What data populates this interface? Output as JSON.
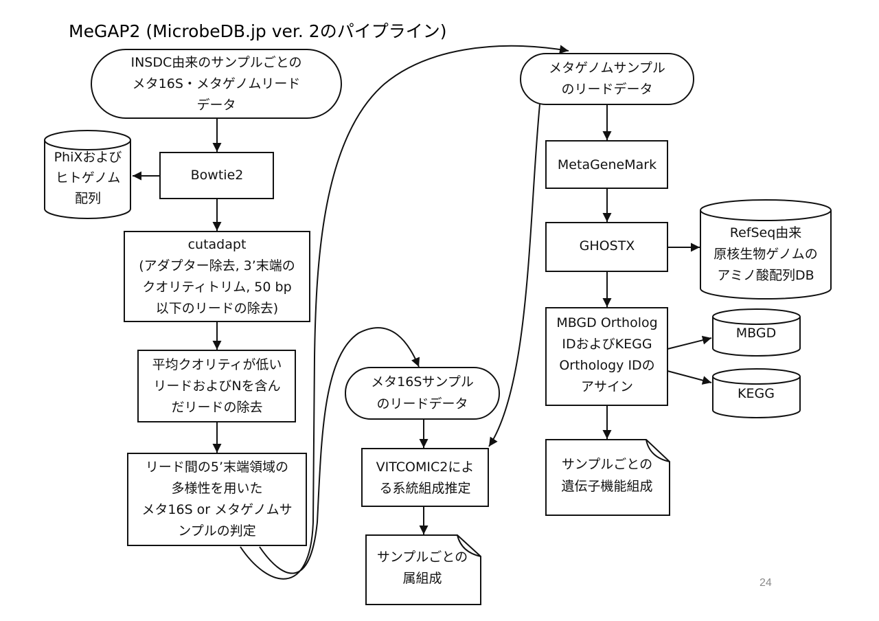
{
  "title": "MeGAP2 (MicrobeDB.jp ver. 2のパイプライン)",
  "page_number": "24",
  "nodes": {
    "insdc_reads": {
      "lines": [
        "INSDC由来のサンプルごとの",
        "メタ16S・メタゲノムリード",
        "データ"
      ]
    },
    "bowtie2": {
      "lines": [
        "Bowtie2"
      ]
    },
    "phix_human": {
      "lines": [
        "PhiXおよび",
        "ヒトゲノム",
        "配列"
      ]
    },
    "cutadapt": {
      "lines": [
        "cutadapt",
        "(アダプター除去, 3’末端の",
        "クオリティトリム, 50 bp",
        "以下のリードの除去)"
      ]
    },
    "quality_filter": {
      "lines": [
        "平均クオリティが低い",
        "リードおよびNを含ん",
        "だリードの除去"
      ]
    },
    "classify": {
      "lines": [
        "リード間の5’末端領域の",
        "多様性を用いた",
        "メタ16S or メタゲノムサ",
        "ンプルの判定"
      ]
    },
    "meta16s_reads": {
      "lines": [
        "メタ16Sサンプル",
        "のリードデータ"
      ]
    },
    "vitcomic2": {
      "lines": [
        "VITCOMIC2によ",
        "る系統組成推定"
      ]
    },
    "genus_composition": {
      "lines": [
        "サンプルごとの",
        "属組成"
      ]
    },
    "metagenome_reads": {
      "lines": [
        "メタゲノムサンプル",
        "のリードデータ"
      ]
    },
    "metagenemark": {
      "lines": [
        "MetaGeneMark"
      ]
    },
    "ghostx": {
      "lines": [
        "GHOSTX"
      ]
    },
    "refseq_db": {
      "lines": [
        "RefSeq由来",
        "原核生物ゲノムの",
        "アミノ酸配列DB"
      ]
    },
    "ortholog_assign": {
      "lines": [
        "MBGD Ortholog",
        "IDおよびKEGG",
        "Orthology IDの",
        "アサイン"
      ]
    },
    "mbgd": {
      "lines": [
        "MBGD"
      ]
    },
    "kegg": {
      "lines": [
        "KEGG"
      ]
    },
    "gene_function": {
      "lines": [
        "サンプルごとの",
        "遺伝子機能組成"
      ]
    }
  }
}
